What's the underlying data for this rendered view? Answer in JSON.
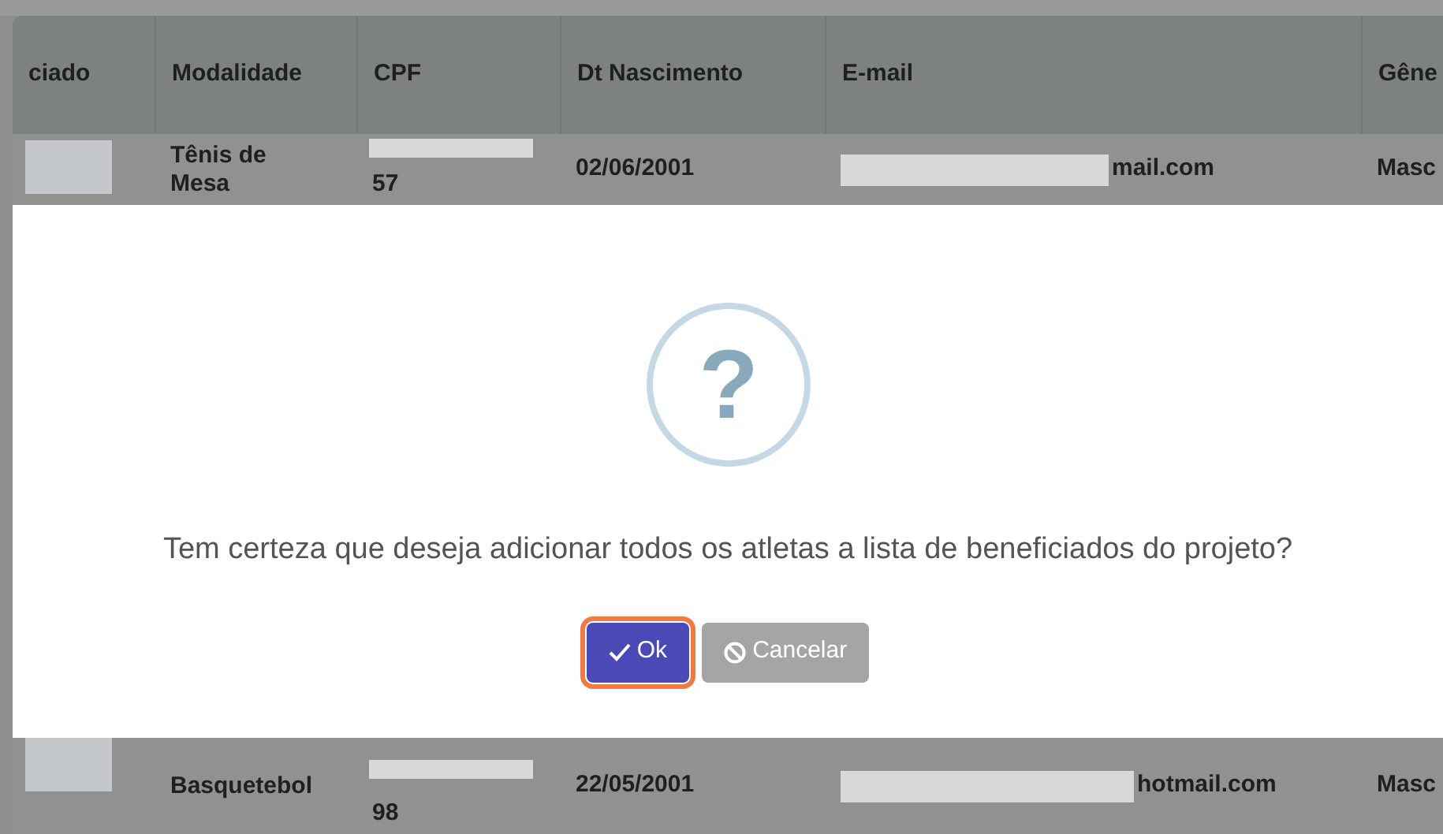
{
  "table": {
    "columns": [
      "ciado",
      "Modalidade",
      "CPF",
      "Dt Nascimento",
      "E-mail",
      "Gêne"
    ],
    "rows": [
      {
        "modalidade": "Tênis de Mesa",
        "cpf": "57",
        "nascimento": "02/06/2001",
        "email": "mail.com",
        "genero": "Masc"
      },
      {
        "modalidade": "Basquetebol",
        "cpf": "98",
        "nascimento": "22/05/2001",
        "email": "hotmail.com",
        "genero": "Masc"
      }
    ]
  },
  "dialog": {
    "icon_glyph": "?",
    "message": "Tem certeza que deseja adicionar todos os atletas a lista de beneficiados do projeto?",
    "buttons": [
      {
        "kind": "confirm",
        "label": "Ok",
        "focused": true
      },
      {
        "kind": "cancel",
        "label": "Cancelar",
        "focused": false
      }
    ]
  }
}
